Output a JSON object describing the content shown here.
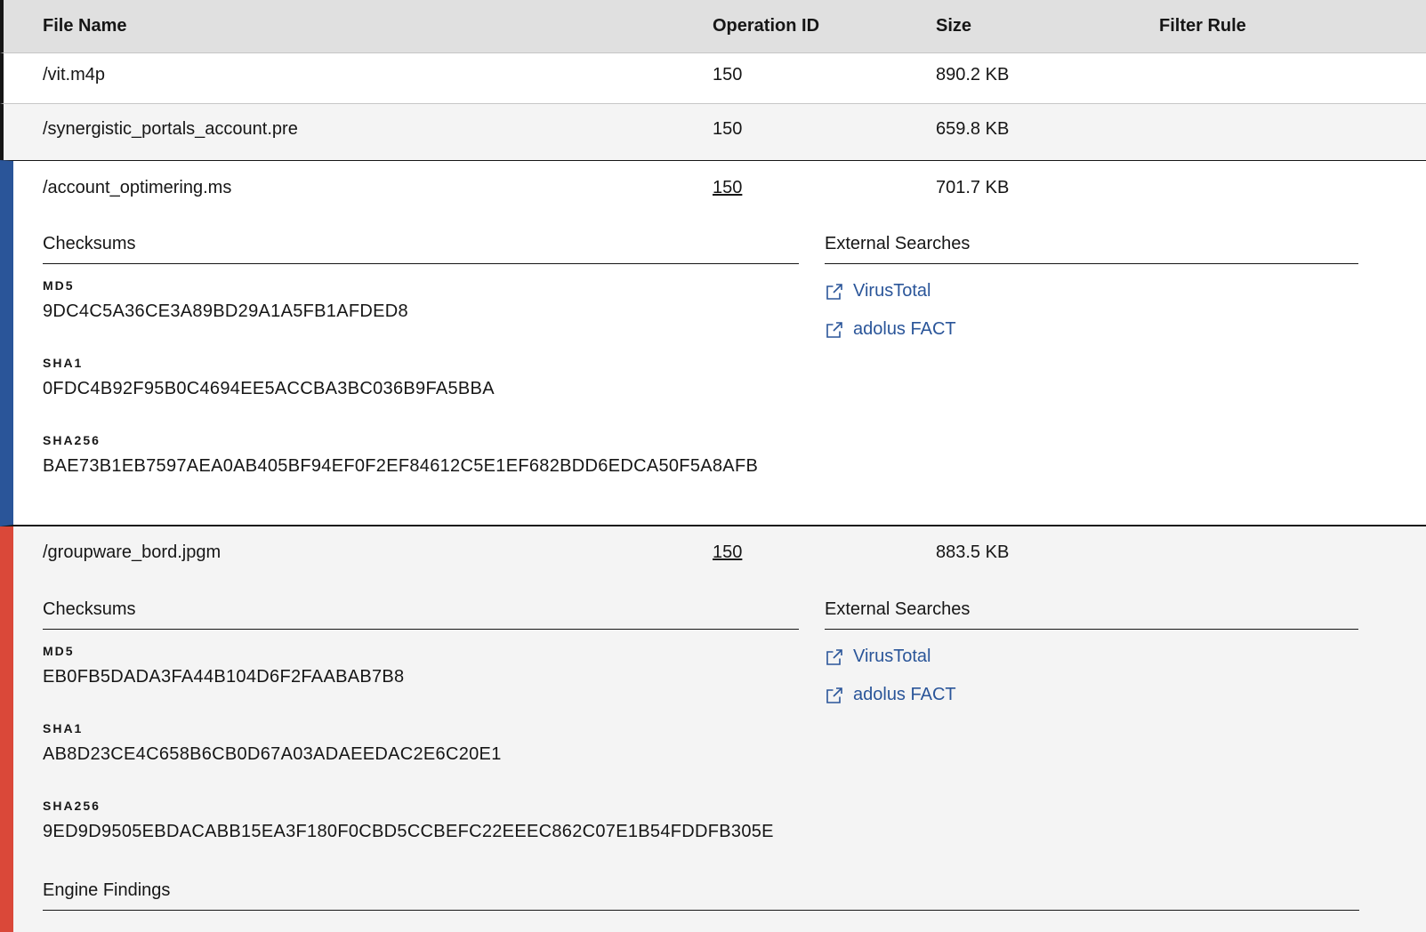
{
  "columns": {
    "file_name": "File Name",
    "operation_id": "Operation ID",
    "size": "Size",
    "filter_rule": "Filter Rule"
  },
  "rows": [
    {
      "name": "/vit.m4p",
      "op": "150",
      "size": "890.2 KB"
    },
    {
      "name": "/synergistic_portals_account.pre",
      "op": "150",
      "size": "659.8 KB"
    }
  ],
  "expanded": [
    {
      "name": "/account_optimering.ms",
      "op": "150",
      "size": "701.7 KB",
      "accent": "#2a5599",
      "checksums_title": "Checksums",
      "external_title": "External Searches",
      "md5_label": "MD5",
      "md5": "9DC4C5A36CE3A89BD29A1A5FB1AFDED8",
      "sha1_label": "SHA1",
      "sha1": "0FDC4B92F95B0C4694EE5ACCBA3BC036B9FA5BBA",
      "sha256_label": "SHA256",
      "sha256": "BAE73B1EB7597AEA0AB405BF94EF0F2EF84612C5E1EF682BDD6EDCA50F5A8AFB",
      "links": [
        "VirusTotal",
        "adolus FACT"
      ]
    },
    {
      "name": "/groupware_bord.jpgm",
      "op": "150",
      "size": "883.5 KB",
      "accent": "#da4839",
      "checksums_title": "Checksums",
      "external_title": "External Searches",
      "md5_label": "MD5",
      "md5": "EB0FB5DADA3FA44B104D6F2FAABAB7B8",
      "sha1_label": "SHA1",
      "sha1": "AB8D23CE4C658B6CB0D67A03ADAEEDAC2E6C20E1",
      "sha256_label": "SHA256",
      "sha256": "9ED9D9505EBDACABB15EA3F180F0CBD5CCBEFC22EEEC862C07E1B54FDDFB305E",
      "links": [
        "VirusTotal",
        "adolus FACT"
      ],
      "engine_title": "Engine Findings"
    }
  ],
  "icons": {
    "external_link": "external-link-icon"
  },
  "colors": {
    "link": "#2a5599",
    "header_bg": "#e0e0e0",
    "alt_row": "#f4f4f4"
  }
}
